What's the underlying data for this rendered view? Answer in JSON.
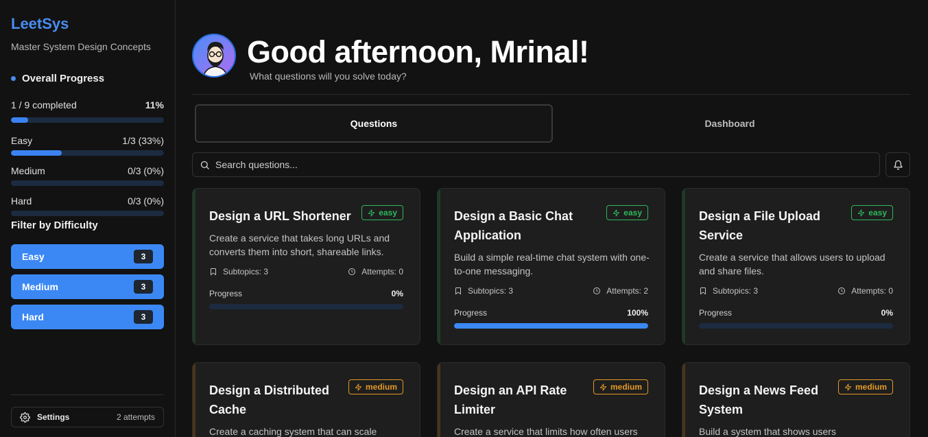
{
  "sidebar": {
    "brand": "LeetSys",
    "tagline": "Master System Design Concepts",
    "overall_title": "Overall Progress",
    "completed_label": "1 / 9 completed",
    "completed_pct": "11%",
    "completed_fraction": 0.11,
    "easy": {
      "label": "Easy",
      "value": "1/3 (33%)",
      "fraction": 0.33
    },
    "medium": {
      "label": "Medium",
      "value": "0/3 (0%)",
      "fraction": 0
    },
    "hard": {
      "label": "Hard",
      "value": "0/3 (0%)",
      "fraction": 0
    },
    "filter_title": "Filter by Difficulty",
    "filters": [
      {
        "label": "Easy",
        "count": "3"
      },
      {
        "label": "Medium",
        "count": "3"
      },
      {
        "label": "Hard",
        "count": "3"
      }
    ],
    "settings_label": "Settings",
    "settings_attempts": "2 attempts"
  },
  "header": {
    "greeting": "Good afternoon, Mrinal!",
    "subtitle": "What questions will you solve today?"
  },
  "tabs": [
    {
      "label": "Questions"
    },
    {
      "label": "Dashboard"
    }
  ],
  "search": {
    "placeholder": "Search questions..."
  },
  "colors": {
    "easy": "#2eb85c",
    "medium": "#e39a26",
    "accent": "#3b88f5"
  },
  "cards": [
    {
      "title": "Design a URL Shortener",
      "badge": "easy",
      "desc": "Create a service that takes long URLs and converts them into short, shareable links.",
      "subtopics": "Subtopics: 3",
      "attempts": "Attempts: 0",
      "progress_label": "Progress",
      "progress": "0%",
      "fraction": 0
    },
    {
      "title": "Design a Basic Chat Application",
      "badge": "easy",
      "desc": "Build a simple real-time chat system with one-to-one messaging.",
      "subtopics": "Subtopics: 3",
      "attempts": "Attempts: 2",
      "progress_label": "Progress",
      "progress": "100%",
      "fraction": 1
    },
    {
      "title": "Design a File Upload Service",
      "badge": "easy",
      "desc": "Create a service that allows users to upload and share files.",
      "subtopics": "Subtopics: 3",
      "attempts": "Attempts: 0",
      "progress_label": "Progress",
      "progress": "0%",
      "fraction": 0
    },
    {
      "title": "Design a Distributed Cache",
      "badge": "medium",
      "desc": "Create a caching system that can scale"
    },
    {
      "title": "Design an API Rate Limiter",
      "badge": "medium",
      "desc": "Create a service that limits how often users"
    },
    {
      "title": "Design a News Feed System",
      "badge": "medium",
      "desc": "Build a system that shows users"
    }
  ]
}
